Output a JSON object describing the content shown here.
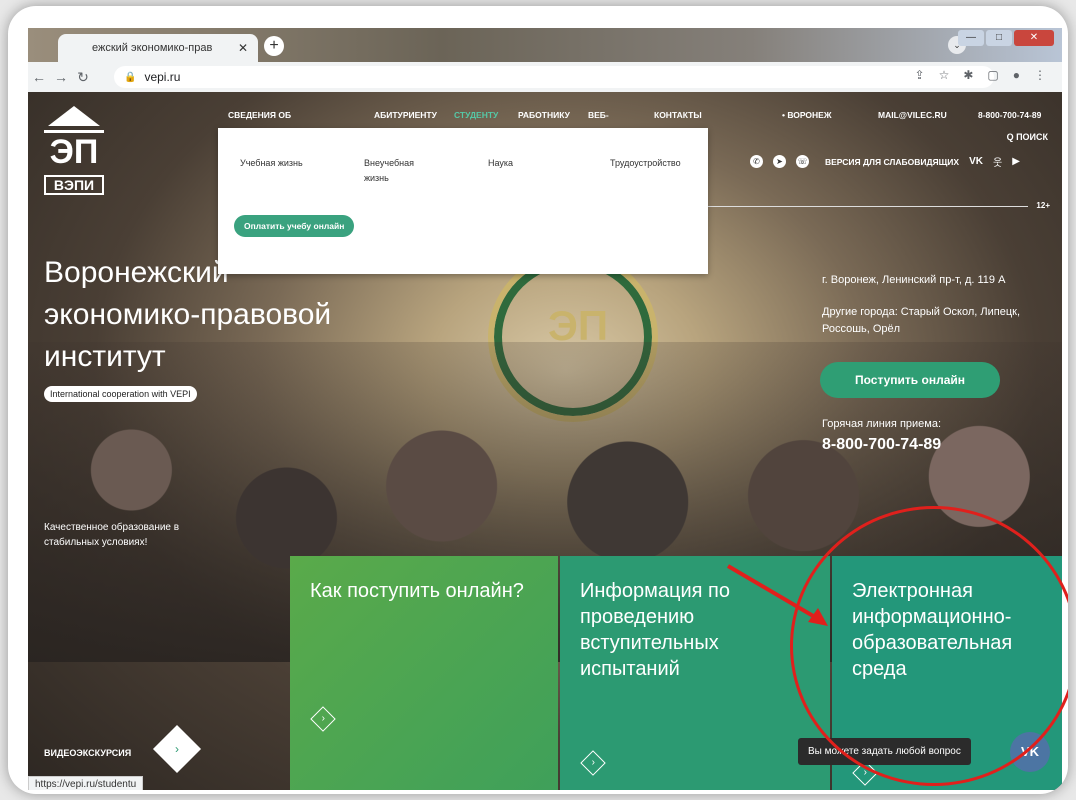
{
  "browser": {
    "tab_title": "ежский экономико-прав",
    "tab_close": "✕",
    "new_tab": "+",
    "url": "vepi.ru",
    "controls": {
      "dropdown": "⌄",
      "minimize": "—",
      "maximize": "□",
      "close": "✕"
    },
    "nav": {
      "back": "←",
      "forward": "→",
      "reload": "↻"
    },
    "omni_icons": [
      "⇪",
      "☆",
      "✱",
      "▢",
      "●",
      "⋮"
    ],
    "status_url": "https://vepi.ru/studentu"
  },
  "site": {
    "logo": {
      "mark": "ЭП",
      "text": "ВЭПИ"
    },
    "nav": [
      {
        "label": "СВЕДЕНИЯ ОБ"
      },
      {
        "label": "АБИТУРИЕНТУ"
      },
      {
        "label": "СТУДЕНТУ"
      },
      {
        "label": "РАБОТНИКУ"
      },
      {
        "label": "ВЕБ-"
      },
      {
        "label": "КОНТАКТЫ"
      }
    ],
    "city": "• ВОРОНЕЖ",
    "email": "MAIL@VILEC.RU",
    "phone_top": "8-800-700-74-89",
    "search": "Q ПОИСК",
    "accessibility": "ВЕРСИЯ ДЛЯ СЛАБОВИДЯЩИХ",
    "age": "12+",
    "dropdown": {
      "items": [
        "Учебная жизнь",
        "Внеучебная жизнь",
        "Наука",
        "Трудоустройство"
      ],
      "pay_button": "Оплатить учебу онлайн"
    },
    "hero": {
      "title": "Воронежский экономико-правовой институт",
      "badge": "International cooperation with VEPI",
      "quality": "Качественное образование в стабильных условиях!",
      "address": "г. Воронеж, Ленинский пр-т, д. 119 А",
      "other_cities": "Другие города: Старый Оскол, Липецк, Россошь, Орёл",
      "apply_button": "Поступить онлайн",
      "hotline_label": "Горячая линия приема:",
      "hotline_number": "8-800-700-74-89"
    },
    "cards": [
      {
        "title": "Как поступить онлайн?"
      },
      {
        "title": "Информация по проведению вступительных испытаний"
      },
      {
        "title": "Электронная информационно-образовательная среда"
      }
    ],
    "video_label": "ВИДЕОЭКСКУРСИЯ",
    "chat_tooltip": "Вы можете задать любой вопрос",
    "chat_button": "VK"
  },
  "colors": {
    "accent_green": "#2c9a72",
    "annotation_red": "#e0201c"
  }
}
